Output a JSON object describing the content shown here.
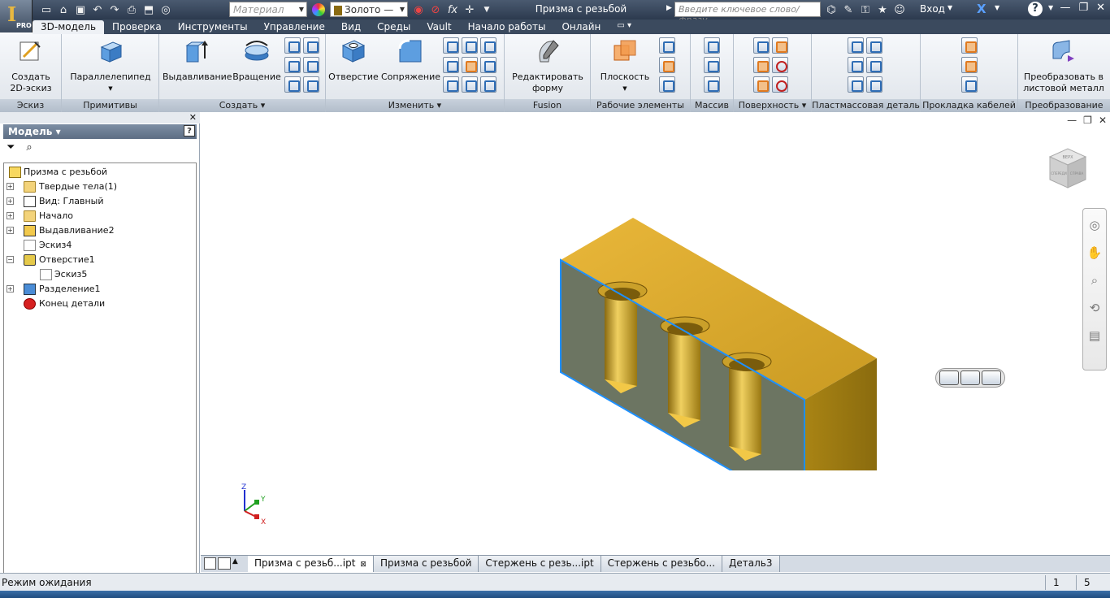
{
  "titlebar": {
    "app_letter": "I",
    "edition": "PRO",
    "material_placeholder": "Материал",
    "appearance_value": "Золото —",
    "title": "Призма с резьбой",
    "search_placeholder": "Введите ключевое слово/фразу",
    "login": "Вход"
  },
  "tabs": [
    {
      "label": "3D-модель",
      "active": true
    },
    {
      "label": "Проверка"
    },
    {
      "label": "Инструменты"
    },
    {
      "label": "Управление"
    },
    {
      "label": "Вид"
    },
    {
      "label": "Среды"
    },
    {
      "label": "Vault"
    },
    {
      "label": "Начало работы"
    },
    {
      "label": "Онлайн"
    }
  ],
  "ribbon": {
    "sketch": {
      "label": "Эскиз",
      "btn1": "Создать",
      "btn2": "2D-эскиз"
    },
    "primitives": {
      "label": "Примитивы",
      "btn": "Параллелепипед"
    },
    "create": {
      "label": "Создать ▾",
      "extrude": "Выдавливание",
      "revolve": "Вращение"
    },
    "modify": {
      "label": "Изменить ▾",
      "hole": "Отверстие",
      "fillet": "Сопряжение"
    },
    "fusion": {
      "label": "Fusion",
      "btn1": "Редактировать",
      "btn2": "форму"
    },
    "work": {
      "label": "Рабочие элементы",
      "plane": "Плоскость"
    },
    "pattern": {
      "label": "Массив"
    },
    "surface": {
      "label": "Поверхность ▾"
    },
    "plastic": {
      "label": "Пластмассовая деталь"
    },
    "cable": {
      "label": "Прокладка кабелей"
    },
    "convert": {
      "label": "Преобразование",
      "btn1": "Преобразовать в",
      "btn2": "листовой металл"
    }
  },
  "browser": {
    "header": "Модель ▾",
    "help": "?",
    "tree": [
      {
        "label": "Призма с резьбой",
        "icon": "part-icon",
        "level": 0
      },
      {
        "label": "Твердые тела(1)",
        "icon": "solid-bodies-icon",
        "level": 1,
        "expander": "+"
      },
      {
        "label": "Вид: Главный",
        "icon": "view-icon",
        "level": 1,
        "expander": "+"
      },
      {
        "label": "Начало",
        "icon": "origin-folder-icon",
        "level": 1,
        "expander": "+"
      },
      {
        "label": "Выдавливание2",
        "icon": "extrude-icon",
        "level": 1,
        "expander": "+"
      },
      {
        "label": "Эскиз4",
        "icon": "sketch-icon",
        "level": 1
      },
      {
        "label": "Отверстие1",
        "icon": "hole-icon",
        "level": 1,
        "expander": "−"
      },
      {
        "label": "Эскиз5",
        "icon": "sketch-icon",
        "level": 2
      },
      {
        "label": "Разделение1",
        "icon": "split-icon",
        "level": 1,
        "expander": "+"
      },
      {
        "label": "Конец детали",
        "icon": "end-of-part-icon",
        "level": 1
      }
    ]
  },
  "viewcube": {
    "face_top": "ВЕРХ",
    "face_front": "СПЕРЕДИ",
    "face_right": "СПРАВА"
  },
  "triad": {
    "x": "X",
    "y": "Y",
    "z": "Z"
  },
  "doc_tabs": [
    {
      "label": "Призма с резьб...ipt",
      "active": true,
      "close": "⊠"
    },
    {
      "label": "Призма с резьбой"
    },
    {
      "label": "Стержень с резь...ipt"
    },
    {
      "label": "Стержень с резьбо..."
    },
    {
      "label": "Деталь3"
    }
  ],
  "status": {
    "text": "Режим ожидания",
    "n1": "1",
    "n2": "5"
  },
  "colors": {
    "gold": "#d8a82a",
    "section": "#6e7766",
    "edge_highlight": "#1e90ff"
  }
}
